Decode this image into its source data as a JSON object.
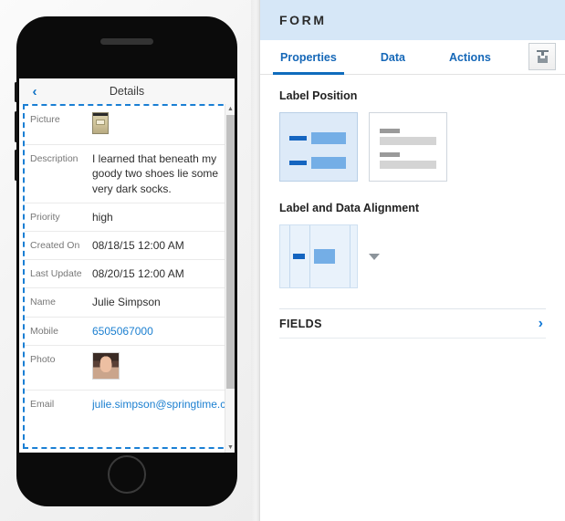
{
  "preview": {
    "device": "phone-mockup",
    "screen": {
      "back_icon": "‹",
      "title": "Details",
      "scrollbar": {
        "up_arrow": "▲",
        "down_arrow": "▼"
      },
      "fields": [
        {
          "label": "Picture",
          "value": "",
          "type": "image-picture"
        },
        {
          "label": "Description",
          "value": "I learned that beneath my goody two shoes lie some very dark socks.",
          "type": "text-wrap"
        },
        {
          "label": "Priority",
          "value": "high",
          "type": "text"
        },
        {
          "label": "Created On",
          "value": "08/18/15 12:00 AM",
          "type": "text"
        },
        {
          "label": "Last Update",
          "value": "08/20/15 12:00 AM",
          "type": "text"
        },
        {
          "label": "Name",
          "value": "Julie Simpson",
          "type": "text"
        },
        {
          "label": "Mobile",
          "value": "6505067000",
          "type": "link"
        },
        {
          "label": "Photo",
          "value": "",
          "type": "image-photo"
        },
        {
          "label": "Email",
          "value": "julie.simpson@springtime.co",
          "type": "link"
        }
      ]
    }
  },
  "panel": {
    "header": {
      "title": "FORM"
    },
    "tabs": [
      {
        "label": "Properties",
        "active": true
      },
      {
        "label": "Data",
        "active": false
      },
      {
        "label": "Actions",
        "active": false
      }
    ],
    "tab_action_button": {
      "icon": "form-tray-icon",
      "label": ""
    },
    "sections": {
      "label_position": {
        "title": "Label Position",
        "options": [
          {
            "name": "label-left",
            "selected": true
          },
          {
            "name": "label-above",
            "selected": false
          }
        ]
      },
      "label_data_alignment": {
        "title": "Label and Data Alignment",
        "selected_option": "label-right-data-left",
        "dropdown_caret": "▼"
      },
      "fields": {
        "title": "FIELDS",
        "chevron": "›"
      }
    }
  },
  "colors": {
    "accent_blue": "#1668b8",
    "header_band": "#d6e7f7",
    "tab_underline": "#0f6cbd",
    "selection_dashed": "#1a7fd4",
    "link_blue": "#1b7fd0",
    "card_selected_bg": "#ddeaf8"
  }
}
